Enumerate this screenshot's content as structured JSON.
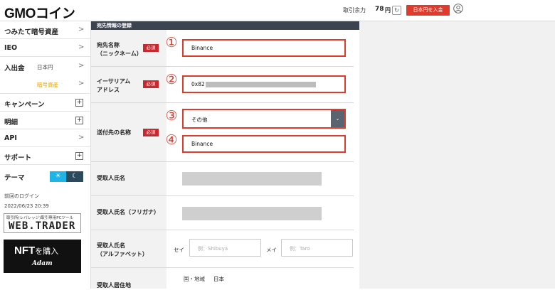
{
  "header": {
    "logo": "GMOコイン",
    "balance_label": "取引余力",
    "balance_value": "78",
    "balance_unit": "円",
    "refresh_icon": "refresh-icon",
    "deposit_button": "日本円を入金",
    "user_icon": "user-icon",
    "accent_color": "#e03a2d"
  },
  "sidebar": {
    "items": [
      {
        "label": "つみたて暗号資産"
      },
      {
        "label": "IEO"
      },
      {
        "label": "入出金",
        "sub": "日本円"
      },
      {
        "sub": "暗号資産"
      },
      {
        "label": "キャンペーン"
      },
      {
        "label": "明細"
      },
      {
        "label": "API"
      },
      {
        "label": "サポート"
      }
    ],
    "theme_label": "テーマ",
    "last_login_label": "前回のログイン",
    "last_login_value": "2022/06/23 20:39",
    "webtrader_sub": "取引所(レバレッジ)取引専用PCツール",
    "webtrader_main": "WEB.TRADER",
    "nft_main": "NFT",
    "nft_small": "を購入",
    "nft_sub": "Adam"
  },
  "form": {
    "section_title": "宛先情報の登録",
    "required_label": "必須",
    "fields": {
      "nickname_label_1": "宛先名称",
      "nickname_label_2": "（ニックネーム）",
      "nickname_value": "Binance",
      "address_label_1": "イーサリアム",
      "address_label_2": "アドレス",
      "address_value": "0x82",
      "destination_label": "送付先の名称",
      "destination_select": "その他",
      "destination_value": "Binance",
      "recipient_name_label": "受取人氏名",
      "recipient_kana_label": "受取人氏名（フリガナ）",
      "recipient_alpha_label_1": "受取人氏名",
      "recipient_alpha_label_2": "（アルファベット）",
      "sei_label": "セイ",
      "sei_placeholder": "例：Shibuya",
      "mei_label": "メイ",
      "mei_placeholder": "例：Taro",
      "residence_label": "受取人居住地",
      "country_label": "国・地域",
      "country_value": "日本"
    },
    "markers": [
      "①",
      "②",
      "③",
      "④"
    ]
  }
}
